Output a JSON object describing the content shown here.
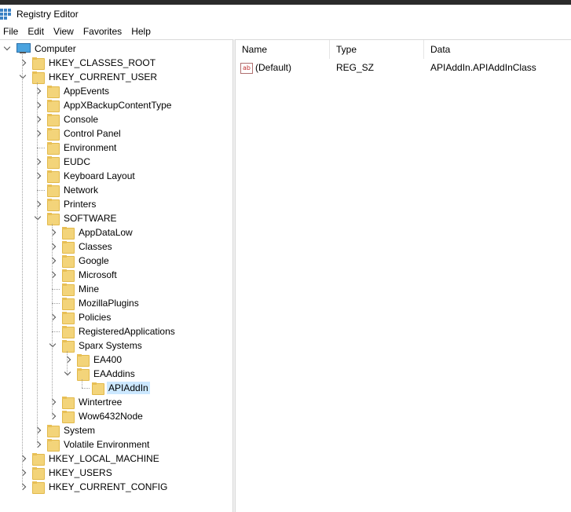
{
  "window": {
    "title": "Registry Editor"
  },
  "menu": [
    "File",
    "Edit",
    "View",
    "Favorites",
    "Help"
  ],
  "tree": {
    "root": "Computer",
    "nodes": [
      {
        "label": "HKEY_CLASSES_ROOT",
        "depth": 1,
        "state": "collapsed"
      },
      {
        "label": "HKEY_CURRENT_USER",
        "depth": 1,
        "state": "expanded"
      },
      {
        "label": "AppEvents",
        "depth": 2,
        "state": "collapsed"
      },
      {
        "label": "AppXBackupContentType",
        "depth": 2,
        "state": "collapsed"
      },
      {
        "label": "Console",
        "depth": 2,
        "state": "collapsed"
      },
      {
        "label": "Control Panel",
        "depth": 2,
        "state": "collapsed"
      },
      {
        "label": "Environment",
        "depth": 2,
        "state": "leaf"
      },
      {
        "label": "EUDC",
        "depth": 2,
        "state": "collapsed"
      },
      {
        "label": "Keyboard Layout",
        "depth": 2,
        "state": "collapsed"
      },
      {
        "label": "Network",
        "depth": 2,
        "state": "leaf"
      },
      {
        "label": "Printers",
        "depth": 2,
        "state": "collapsed"
      },
      {
        "label": "SOFTWARE",
        "depth": 2,
        "state": "expanded"
      },
      {
        "label": "AppDataLow",
        "depth": 3,
        "state": "collapsed"
      },
      {
        "label": "Classes",
        "depth": 3,
        "state": "collapsed"
      },
      {
        "label": "Google",
        "depth": 3,
        "state": "collapsed"
      },
      {
        "label": "Microsoft",
        "depth": 3,
        "state": "collapsed"
      },
      {
        "label": "Mine",
        "depth": 3,
        "state": "leaf"
      },
      {
        "label": "MozillaPlugins",
        "depth": 3,
        "state": "leaf"
      },
      {
        "label": "Policies",
        "depth": 3,
        "state": "collapsed"
      },
      {
        "label": "RegisteredApplications",
        "depth": 3,
        "state": "leaf"
      },
      {
        "label": "Sparx Systems",
        "depth": 3,
        "state": "expanded"
      },
      {
        "label": "EA400",
        "depth": 4,
        "state": "collapsed"
      },
      {
        "label": "EAAddins",
        "depth": 4,
        "state": "expanded"
      },
      {
        "label": "APIAddIn",
        "depth": 5,
        "state": "leaf",
        "selected": true
      },
      {
        "label": "Wintertree",
        "depth": 3,
        "state": "collapsed"
      },
      {
        "label": "Wow6432Node",
        "depth": 3,
        "state": "collapsed"
      },
      {
        "label": "System",
        "depth": 2,
        "state": "collapsed"
      },
      {
        "label": "Volatile Environment",
        "depth": 2,
        "state": "collapsed"
      },
      {
        "label": "HKEY_LOCAL_MACHINE",
        "depth": 1,
        "state": "collapsed"
      },
      {
        "label": "HKEY_USERS",
        "depth": 1,
        "state": "collapsed"
      },
      {
        "label": "HKEY_CURRENT_CONFIG",
        "depth": 1,
        "state": "collapsed"
      }
    ]
  },
  "list": {
    "columns": [
      "Name",
      "Type",
      "Data"
    ],
    "rows": [
      {
        "name": "(Default)",
        "type": "REG_SZ",
        "data": "APIAddIn.APIAddInClass",
        "icon": "string-value-icon"
      }
    ]
  }
}
